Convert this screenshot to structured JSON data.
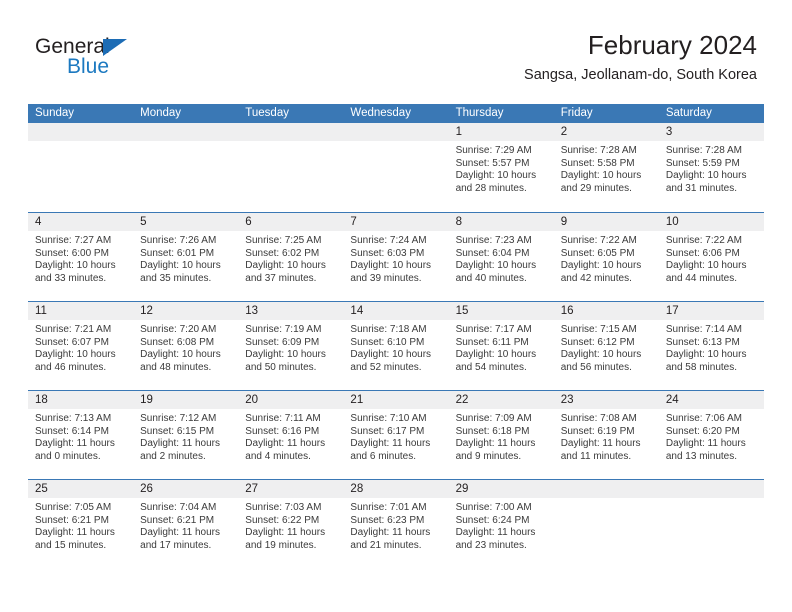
{
  "brand": {
    "name_part1": "General",
    "name_part2": "Blue"
  },
  "header": {
    "title": "February 2024",
    "subtitle": "Sangsa, Jeollanam-do, South Korea"
  },
  "colors": {
    "header_blue": "#3a78b5",
    "brand_blue": "#1c79c0",
    "daynum_band": "#efeff0",
    "text": "#231f20"
  },
  "weekdays": [
    "Sunday",
    "Monday",
    "Tuesday",
    "Wednesday",
    "Thursday",
    "Friday",
    "Saturday"
  ],
  "weeks": [
    [
      {
        "day": "",
        "lines": []
      },
      {
        "day": "",
        "lines": []
      },
      {
        "day": "",
        "lines": []
      },
      {
        "day": "",
        "lines": []
      },
      {
        "day": "1",
        "lines": [
          "Sunrise: 7:29 AM",
          "Sunset: 5:57 PM",
          "Daylight: 10 hours",
          "and 28 minutes."
        ]
      },
      {
        "day": "2",
        "lines": [
          "Sunrise: 7:28 AM",
          "Sunset: 5:58 PM",
          "Daylight: 10 hours",
          "and 29 minutes."
        ]
      },
      {
        "day": "3",
        "lines": [
          "Sunrise: 7:28 AM",
          "Sunset: 5:59 PM",
          "Daylight: 10 hours",
          "and 31 minutes."
        ]
      }
    ],
    [
      {
        "day": "4",
        "lines": [
          "Sunrise: 7:27 AM",
          "Sunset: 6:00 PM",
          "Daylight: 10 hours",
          "and 33 minutes."
        ]
      },
      {
        "day": "5",
        "lines": [
          "Sunrise: 7:26 AM",
          "Sunset: 6:01 PM",
          "Daylight: 10 hours",
          "and 35 minutes."
        ]
      },
      {
        "day": "6",
        "lines": [
          "Sunrise: 7:25 AM",
          "Sunset: 6:02 PM",
          "Daylight: 10 hours",
          "and 37 minutes."
        ]
      },
      {
        "day": "7",
        "lines": [
          "Sunrise: 7:24 AM",
          "Sunset: 6:03 PM",
          "Daylight: 10 hours",
          "and 39 minutes."
        ]
      },
      {
        "day": "8",
        "lines": [
          "Sunrise: 7:23 AM",
          "Sunset: 6:04 PM",
          "Daylight: 10 hours",
          "and 40 minutes."
        ]
      },
      {
        "day": "9",
        "lines": [
          "Sunrise: 7:22 AM",
          "Sunset: 6:05 PM",
          "Daylight: 10 hours",
          "and 42 minutes."
        ]
      },
      {
        "day": "10",
        "lines": [
          "Sunrise: 7:22 AM",
          "Sunset: 6:06 PM",
          "Daylight: 10 hours",
          "and 44 minutes."
        ]
      }
    ],
    [
      {
        "day": "11",
        "lines": [
          "Sunrise: 7:21 AM",
          "Sunset: 6:07 PM",
          "Daylight: 10 hours",
          "and 46 minutes."
        ]
      },
      {
        "day": "12",
        "lines": [
          "Sunrise: 7:20 AM",
          "Sunset: 6:08 PM",
          "Daylight: 10 hours",
          "and 48 minutes."
        ]
      },
      {
        "day": "13",
        "lines": [
          "Sunrise: 7:19 AM",
          "Sunset: 6:09 PM",
          "Daylight: 10 hours",
          "and 50 minutes."
        ]
      },
      {
        "day": "14",
        "lines": [
          "Sunrise: 7:18 AM",
          "Sunset: 6:10 PM",
          "Daylight: 10 hours",
          "and 52 minutes."
        ]
      },
      {
        "day": "15",
        "lines": [
          "Sunrise: 7:17 AM",
          "Sunset: 6:11 PM",
          "Daylight: 10 hours",
          "and 54 minutes."
        ]
      },
      {
        "day": "16",
        "lines": [
          "Sunrise: 7:15 AM",
          "Sunset: 6:12 PM",
          "Daylight: 10 hours",
          "and 56 minutes."
        ]
      },
      {
        "day": "17",
        "lines": [
          "Sunrise: 7:14 AM",
          "Sunset: 6:13 PM",
          "Daylight: 10 hours",
          "and 58 minutes."
        ]
      }
    ],
    [
      {
        "day": "18",
        "lines": [
          "Sunrise: 7:13 AM",
          "Sunset: 6:14 PM",
          "Daylight: 11 hours",
          "and 0 minutes."
        ]
      },
      {
        "day": "19",
        "lines": [
          "Sunrise: 7:12 AM",
          "Sunset: 6:15 PM",
          "Daylight: 11 hours",
          "and 2 minutes."
        ]
      },
      {
        "day": "20",
        "lines": [
          "Sunrise: 7:11 AM",
          "Sunset: 6:16 PM",
          "Daylight: 11 hours",
          "and 4 minutes."
        ]
      },
      {
        "day": "21",
        "lines": [
          "Sunrise: 7:10 AM",
          "Sunset: 6:17 PM",
          "Daylight: 11 hours",
          "and 6 minutes."
        ]
      },
      {
        "day": "22",
        "lines": [
          "Sunrise: 7:09 AM",
          "Sunset: 6:18 PM",
          "Daylight: 11 hours",
          "and 9 minutes."
        ]
      },
      {
        "day": "23",
        "lines": [
          "Sunrise: 7:08 AM",
          "Sunset: 6:19 PM",
          "Daylight: 11 hours",
          "and 11 minutes."
        ]
      },
      {
        "day": "24",
        "lines": [
          "Sunrise: 7:06 AM",
          "Sunset: 6:20 PM",
          "Daylight: 11 hours",
          "and 13 minutes."
        ]
      }
    ],
    [
      {
        "day": "25",
        "lines": [
          "Sunrise: 7:05 AM",
          "Sunset: 6:21 PM",
          "Daylight: 11 hours",
          "and 15 minutes."
        ]
      },
      {
        "day": "26",
        "lines": [
          "Sunrise: 7:04 AM",
          "Sunset: 6:21 PM",
          "Daylight: 11 hours",
          "and 17 minutes."
        ]
      },
      {
        "day": "27",
        "lines": [
          "Sunrise: 7:03 AM",
          "Sunset: 6:22 PM",
          "Daylight: 11 hours",
          "and 19 minutes."
        ]
      },
      {
        "day": "28",
        "lines": [
          "Sunrise: 7:01 AM",
          "Sunset: 6:23 PM",
          "Daylight: 11 hours",
          "and 21 minutes."
        ]
      },
      {
        "day": "29",
        "lines": [
          "Sunrise: 7:00 AM",
          "Sunset: 6:24 PM",
          "Daylight: 11 hours",
          "and 23 minutes."
        ]
      },
      {
        "day": "",
        "lines": []
      },
      {
        "day": "",
        "lines": []
      }
    ]
  ]
}
